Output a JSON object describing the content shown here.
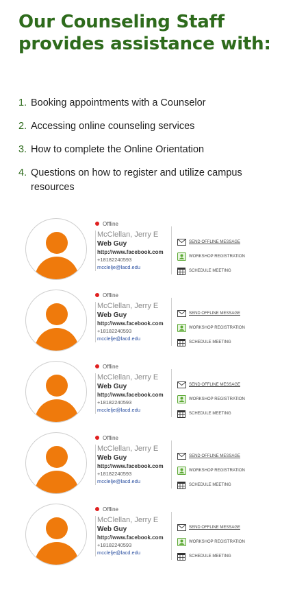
{
  "heading": "Our Counseling Staff provides assistance with:",
  "services": [
    {
      "num": "1.",
      "text": "Booking appointments with a Counselor"
    },
    {
      "num": "2.",
      "text": "Accessing online counseling services"
    },
    {
      "num": "3.",
      "text": "How to complete the Online Orientation"
    },
    {
      "num": "4.",
      "text": "Questions on how to register and utilize campus resources"
    }
  ],
  "colors": {
    "accent": "#2e6b1c",
    "avatar": "#ef7a0c",
    "offline": "#e02020"
  },
  "counselors": [
    {
      "status": "Offline",
      "name": "McClellan, Jerry E",
      "role": "Web Guy",
      "url": "http://www.facebook.com",
      "phone": "+18182240593",
      "email": "mcclelje@lacd.edu"
    },
    {
      "status": "Offline",
      "name": "McClellan, Jerry E",
      "role": "Web Guy",
      "url": "http://www.facebook.com",
      "phone": "+18182240593",
      "email": "mcclelje@lacd.edu"
    },
    {
      "status": "Offline",
      "name": "McClellan, Jerry E",
      "role": "Web Guy",
      "url": "http://www.facebook.com",
      "phone": "+18182240593",
      "email": "mcclelje@lacd.edu"
    },
    {
      "status": "Offline",
      "name": "McClellan, Jerry E",
      "role": "Web Guy",
      "url": "http://www.facebook.com",
      "phone": "+18182240593",
      "email": "mcclelje@lacd.edu"
    },
    {
      "status": "Offline",
      "name": "McClellan, Jerry E",
      "role": "Web Guy",
      "url": "http://www.facebook.com",
      "phone": "+18182240593",
      "email": "mcclelje@lacd.edu"
    }
  ],
  "actions": {
    "offline_message": "SEND OFFLINE MESSAGE",
    "workshop": "WORKSHOP REGISTRATION",
    "schedule": "SCHEDULE MEETING"
  },
  "icons": {
    "offline_message": "envelope-icon",
    "workshop": "workshop-icon",
    "schedule": "calendar-icon"
  }
}
